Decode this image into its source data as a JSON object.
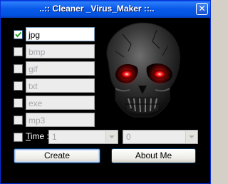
{
  "window": {
    "title": "..:: Cleaner _Virus_Maker ::..",
    "close_glyph": "✕"
  },
  "extensions": [
    {
      "label": "jpg",
      "checked": true
    },
    {
      "label": "bmp",
      "checked": false
    },
    {
      "label": "gif",
      "checked": false
    },
    {
      "label": "txt",
      "checked": false
    },
    {
      "label": "exe",
      "checked": false
    },
    {
      "label": "mp3",
      "checked": false
    }
  ],
  "time": {
    "label_mnemonic": "T",
    "label_rest": "ime :",
    "value1": "1",
    "value2": "0",
    "checked": false
  },
  "buttons": {
    "create": "Create",
    "about": "About Me"
  },
  "colors": {
    "skull_eyes": "#ff1a1a",
    "window_bg": "#000000",
    "titlebar": "#0054e3"
  },
  "icons": {
    "close": "close-icon",
    "check": "check-icon",
    "skull": "skull-image"
  }
}
